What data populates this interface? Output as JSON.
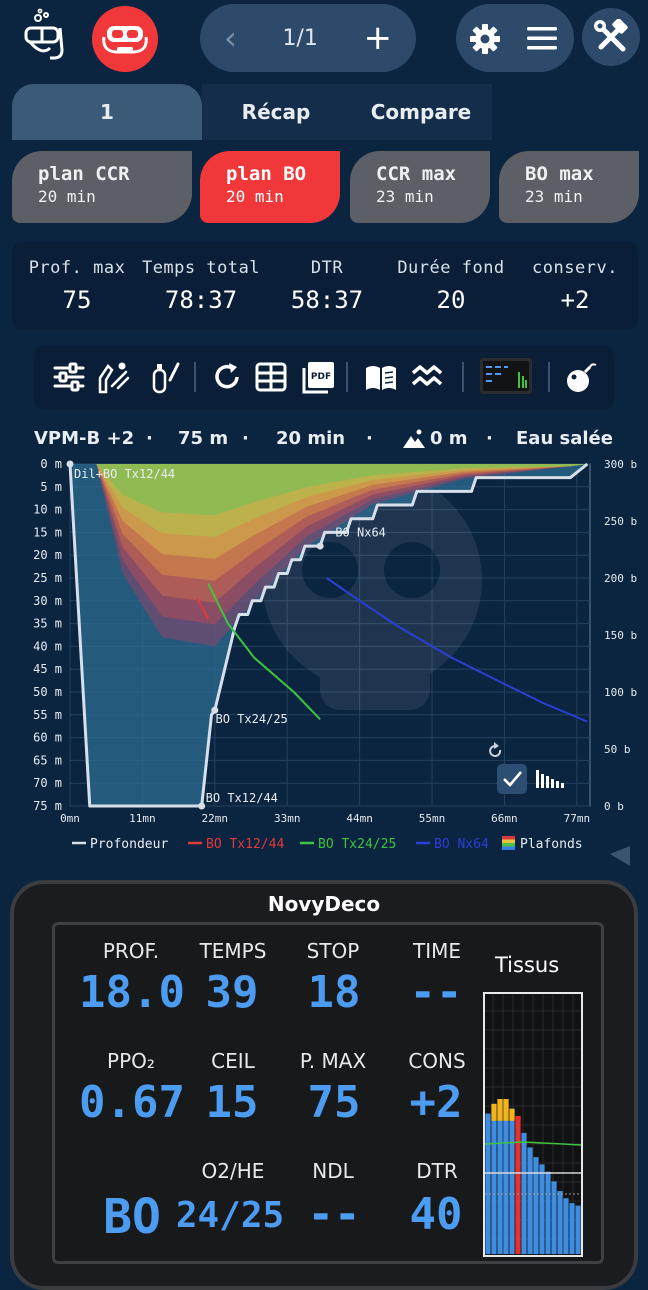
{
  "topbar": {
    "pager_text": "1/1",
    "prev_symbol": "‹",
    "add_symbol": "+"
  },
  "tabs": [
    "1",
    "Récap",
    "Compare"
  ],
  "plans": [
    {
      "name": "plan CCR",
      "time": "20 min",
      "selected": false
    },
    {
      "name": "plan BO",
      "time": "20 min",
      "selected": true
    },
    {
      "name": "CCR max",
      "time": "23 min",
      "selected": false
    },
    {
      "name": "BO max",
      "time": "23 min",
      "selected": false
    }
  ],
  "stats": [
    {
      "label": "Prof. max",
      "value": "75"
    },
    {
      "label": "Temps total",
      "value": "78:37"
    },
    {
      "label": "DTR",
      "value": "58:37"
    },
    {
      "label": "Durée fond",
      "value": "20"
    },
    {
      "label": "conserv.",
      "value": "+2"
    }
  ],
  "toolbar_icons": [
    "sliders-icon",
    "diver-icon",
    "tank-icon",
    "refresh-icon",
    "table-icon",
    "pdf-icon",
    "book-icon",
    "waves-icon",
    "dive-computer-icon",
    "bomb-icon"
  ],
  "chart_header": {
    "model": "VPM-B +2",
    "depth": "75 m",
    "time": "20 min",
    "altitude": "0 m",
    "water": "Eau salée",
    "sep": "·"
  },
  "chart_data": {
    "type": "line",
    "x_ticks": [
      "0mn",
      "11mn",
      "22mn",
      "33mn",
      "44mn",
      "55mn",
      "66mn",
      "77mn"
    ],
    "y_ticks": [
      "0 m",
      "5 m",
      "10 m",
      "15 m",
      "20 m",
      "25 m",
      "30 m",
      "35 m",
      "40 m",
      "45 m",
      "50 m",
      "55 m",
      "60 m",
      "65 m",
      "70 m",
      "75 m"
    ],
    "y2_ticks": [
      "300 b",
      "250 b",
      "200 b",
      "150 b",
      "100 b",
      "50 b",
      "0 b"
    ],
    "xlim": [
      0,
      79
    ],
    "ylim": [
      0,
      75
    ],
    "y2lim": [
      0,
      300
    ],
    "series": [
      {
        "name": "Profondeur",
        "color": "#d6dfea",
        "x": [
          0,
          3,
          20,
          21.5,
          22,
          25,
          25.7,
          27,
          27.7,
          29,
          29.7,
          31,
          31.7,
          33,
          33.7,
          35,
          35.7,
          38,
          38.7,
          42,
          42.7,
          46,
          46.7,
          52,
          52.7,
          61,
          61.7,
          76,
          78.6
        ],
        "y": [
          0,
          75,
          75,
          55,
          54,
          36,
          33,
          33,
          30,
          30,
          27,
          27,
          24,
          24,
          21,
          21,
          18,
          18,
          15,
          15,
          12,
          12,
          9,
          9,
          6,
          6,
          3,
          3,
          0
        ]
      },
      {
        "name": "BO Tx12/44",
        "color": "#e03a3a",
        "x": [
          19.3,
          20.3,
          21.0
        ],
        "y": [
          182,
          172,
          164
        ]
      },
      {
        "name": "BO Tx24/25",
        "color": "#3ec43e",
        "x": [
          21,
          24,
          28,
          34,
          38
        ],
        "y": [
          195,
          160,
          130,
          100,
          76
        ]
      },
      {
        "name": "BO Nx64",
        "color": "#2b3fd6",
        "x": [
          39,
          44,
          50,
          58,
          66,
          72,
          78.6
        ],
        "y": [
          200,
          180,
          157,
          130,
          107,
          90,
          74
        ]
      }
    ],
    "annotations": [
      {
        "text": "Dil+BO Tx12/44",
        "x": 0,
        "y": 0
      },
      {
        "text": "BO Nx64",
        "x": 39.4,
        "y": 15
      },
      {
        "text": "BO Tx24/25",
        "x": 21.5,
        "y": 55
      },
      {
        "text": "BO Tx12/44",
        "x": 20,
        "y": 75
      }
    ],
    "legend": [
      "Profondeur",
      "BO Tx12/44",
      "BO Tx24/25",
      "BO Nx64",
      "Plafonds"
    ],
    "legend_placement": "bottom"
  },
  "panel": {
    "title": "NovyDeco",
    "cells": [
      {
        "label": "PROF.",
        "value": "18.0"
      },
      {
        "label": "TEMPS",
        "value": "39"
      },
      {
        "label": "STOP",
        "value": "18"
      },
      {
        "label": "TIME",
        "value": "--"
      },
      {
        "label": "PPO₂",
        "value": "0.67"
      },
      {
        "label": "CEIL",
        "value": "15"
      },
      {
        "label": "P. MAX",
        "value": "75"
      },
      {
        "label": "CONS",
        "value": "+2"
      },
      {
        "label": "",
        "value": "BO"
      },
      {
        "label": "O2/HE",
        "value": "24/25"
      },
      {
        "label": "NDL",
        "value": "--"
      },
      {
        "label": "DTR",
        "value": "40"
      }
    ],
    "tissus_label": "Tissus",
    "tissues": [
      0.58,
      0.62,
      0.64,
      0.64,
      0.6,
      0.57,
      0.5,
      0.44,
      0.4,
      0.37,
      0.34,
      0.3,
      0.26,
      0.23,
      0.21,
      0.2
    ],
    "tissue_colors": {
      "normal": "#3f8de0",
      "over": "#e8312f",
      "cap": "#f4b31a"
    }
  }
}
